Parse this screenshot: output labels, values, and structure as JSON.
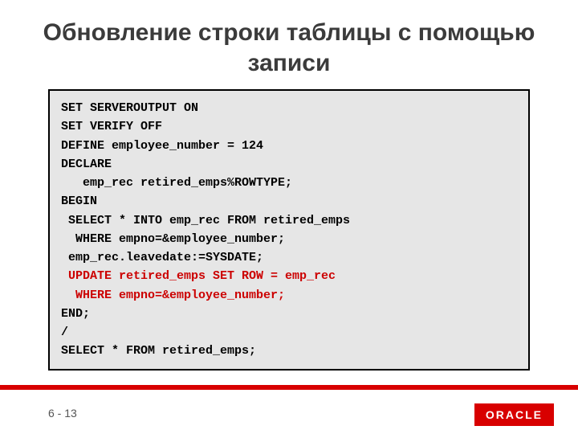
{
  "title": "Обновление строки таблицы с помощью записи",
  "code": {
    "l1": "SET SERVEROUTPUT ON",
    "l2": "SET VERIFY OFF",
    "l3": "DEFINE employee_number = 124",
    "l4": "DECLARE",
    "l5": "   emp_rec retired_emps%ROWTYPE;",
    "l6": "BEGIN",
    "l7": " SELECT * INTO emp_rec FROM retired_emps",
    "l8": "  WHERE empno=&employee_number;",
    "l9": " emp_rec.leavedate:=SYSDATE;",
    "l10": " UPDATE retired_emps SET ROW = emp_rec",
    "l11": "  WHERE empno=&employee_number;",
    "l12": "END;",
    "l13": "/",
    "l14": "SELECT * FROM retired_emps;"
  },
  "slide_number": "6 - 13",
  "logo_text": "ORACLE"
}
